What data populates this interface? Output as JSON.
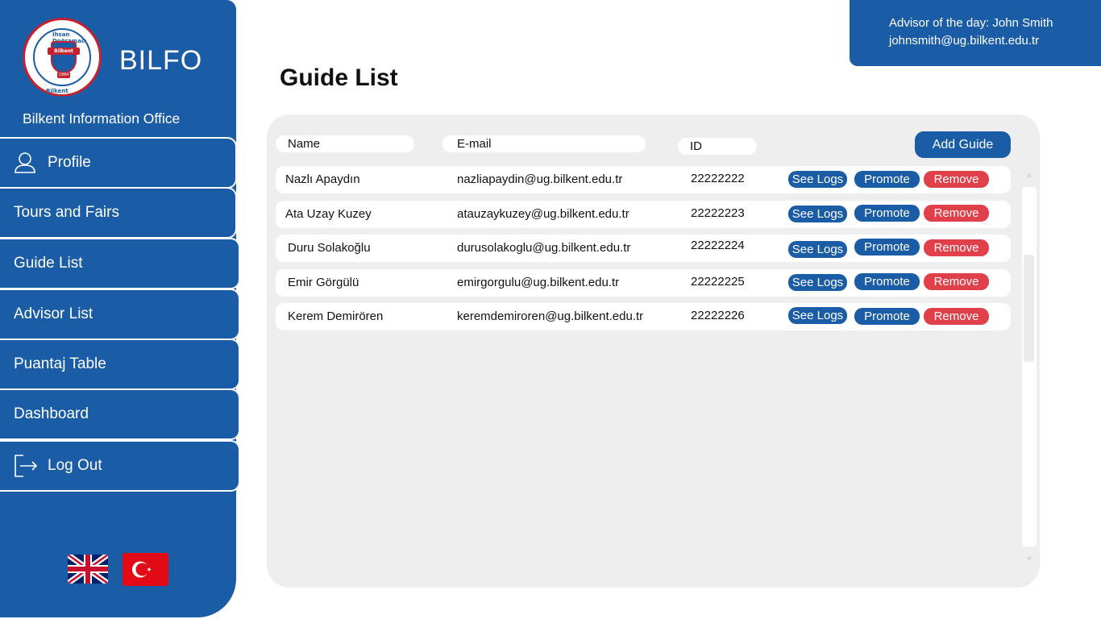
{
  "sidebar": {
    "app_name": "BILFO",
    "subtitle": "Bilkent Information Office",
    "logo": {
      "top_text": "İhsan Doğramacı",
      "band_text": "Bilkent",
      "year": "1984",
      "bottom_text": "Bilkent Üniversitesi"
    },
    "items": [
      {
        "label": "Profile",
        "icon": "user-icon"
      },
      {
        "label": "Tours and Fairs"
      },
      {
        "label": "Guide List"
      },
      {
        "label": "Advisor List"
      },
      {
        "label": "Puantaj Table"
      },
      {
        "label": "Dashboard"
      },
      {
        "label": "Log Out",
        "icon": "logout-icon"
      }
    ],
    "languages": [
      "uk-flag-icon",
      "turkey-flag-icon"
    ]
  },
  "advisor": {
    "line1": "Advisor of the day: John Smith",
    "line2": "johnsmith@ug.bilkent.edu.tr"
  },
  "page": {
    "title": "Guide List"
  },
  "table": {
    "columns": [
      "Name",
      "E-mail",
      "ID"
    ],
    "add_label": "Add Guide",
    "actions": {
      "logs": "See Logs",
      "promote": "Promote",
      "remove": "Remove"
    },
    "rows": [
      {
        "name": "Nazlı Apaydın",
        "email": "nazliapaydin@ug.bilkent.edu.tr",
        "id": "22222222"
      },
      {
        "name": "Ata Uzay Kuzey",
        "email": "atauzaykuzey@ug.bilkent.edu.tr",
        "id": "22222223"
      },
      {
        "name": "Duru Solakoğlu",
        "email": "durusolakoglu@ug.bilkent.edu.tr",
        "id": "22222224"
      },
      {
        "name": "Emir Görgülü",
        "email": "emirgorgulu@ug.bilkent.edu.tr",
        "id": "22222225"
      },
      {
        "name": "Kerem Demirören",
        "email": "keremdemiroren@ug.bilkent.edu.tr",
        "id": "22222226"
      }
    ]
  },
  "colors": {
    "primary": "#1a5ca6",
    "danger": "#e0404a",
    "panel": "#eeeeee"
  }
}
